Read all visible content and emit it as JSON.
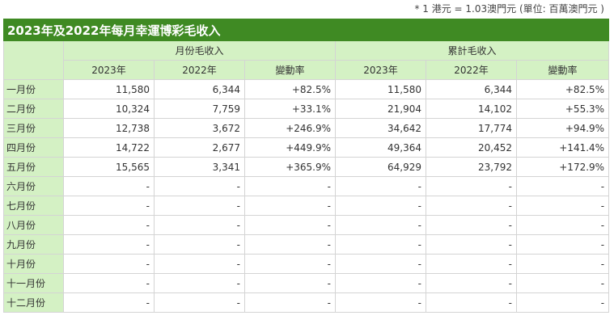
{
  "note": "* 1 港元 = 1.03澳門元 (單位: 百萬澳門元 )",
  "title": "2023年及2022年每月幸運博彩毛收入",
  "group_headers": [
    "月份毛收入",
    "累計毛收入"
  ],
  "sub_headers": [
    "2023年",
    "2022年",
    "變動率",
    "2023年",
    "2022年",
    "變動率"
  ],
  "rows": [
    {
      "month": "一月份",
      "cells": [
        "11,580",
        "6,344",
        "+82.5%",
        "11,580",
        "6,344",
        "+82.5%"
      ]
    },
    {
      "month": "二月份",
      "cells": [
        "10,324",
        "7,759",
        "+33.1%",
        "21,904",
        "14,102",
        "+55.3%"
      ]
    },
    {
      "month": "三月份",
      "cells": [
        "12,738",
        "3,672",
        "+246.9%",
        "34,642",
        "17,774",
        "+94.9%"
      ]
    },
    {
      "month": "四月份",
      "cells": [
        "14,722",
        "2,677",
        "+449.9%",
        "49,364",
        "20,452",
        "+141.4%"
      ]
    },
    {
      "month": "五月份",
      "cells": [
        "15,565",
        "3,341",
        "+365.9%",
        "64,929",
        "23,792",
        "+172.9%"
      ]
    },
    {
      "month": "六月份",
      "cells": [
        "-",
        "-",
        "-",
        "-",
        "-",
        "-"
      ]
    },
    {
      "month": "七月份",
      "cells": [
        "-",
        "-",
        "-",
        "-",
        "-",
        "-"
      ]
    },
    {
      "month": "八月份",
      "cells": [
        "-",
        "-",
        "-",
        "-",
        "-",
        "-"
      ]
    },
    {
      "month": "九月份",
      "cells": [
        "-",
        "-",
        "-",
        "-",
        "-",
        "-"
      ]
    },
    {
      "month": "十月份",
      "cells": [
        "-",
        "-",
        "-",
        "-",
        "-",
        "-"
      ]
    },
    {
      "month": "十一月份",
      "cells": [
        "-",
        "-",
        "-",
        "-",
        "-",
        "-"
      ]
    },
    {
      "month": "十二月份",
      "cells": [
        "-",
        "-",
        "-",
        "-",
        "-",
        "-"
      ]
    }
  ]
}
